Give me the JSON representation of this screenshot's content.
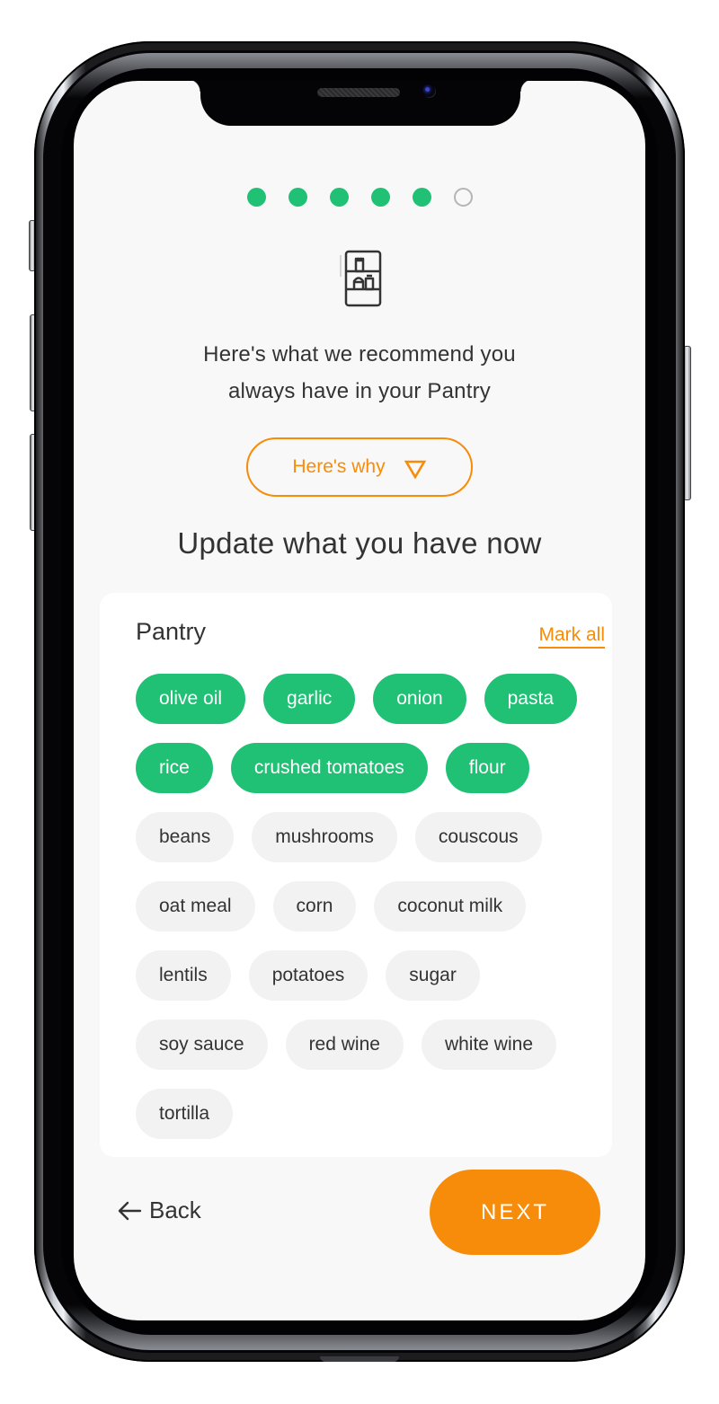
{
  "colors": {
    "accent_green": "#20c075",
    "accent_orange": "#f68c09",
    "text_primary": "#333333",
    "chip_unselected_bg": "#f2f2f2",
    "screen_bg": "#f8f8f8"
  },
  "progress": {
    "total_steps": 6,
    "completed_steps": 5,
    "steps": [
      {
        "state": "filled"
      },
      {
        "state": "filled"
      },
      {
        "state": "filled"
      },
      {
        "state": "filled"
      },
      {
        "state": "filled"
      },
      {
        "state": "empty"
      }
    ]
  },
  "header": {
    "icon": "pantry-shelf-icon",
    "intro_line1": "Here's what we recommend you",
    "intro_line2": "always have in your Pantry",
    "why_button_label": "Here's why",
    "why_button_icon": "triangle-down-icon",
    "update_heading": "Update what you have now"
  },
  "pantry": {
    "title": "Pantry",
    "mark_all_label": "Mark all",
    "items": [
      {
        "label": "olive oil",
        "selected": true
      },
      {
        "label": "garlic",
        "selected": true
      },
      {
        "label": "onion",
        "selected": true
      },
      {
        "label": "pasta",
        "selected": true
      },
      {
        "label": "rice",
        "selected": true
      },
      {
        "label": "crushed tomatoes",
        "selected": true
      },
      {
        "label": "flour",
        "selected": true
      },
      {
        "label": "beans",
        "selected": false
      },
      {
        "label": "mushrooms",
        "selected": false
      },
      {
        "label": "couscous",
        "selected": false
      },
      {
        "label": "oat meal",
        "selected": false
      },
      {
        "label": "corn",
        "selected": false
      },
      {
        "label": "coconut milk",
        "selected": false
      },
      {
        "label": "lentils",
        "selected": false
      },
      {
        "label": "potatoes",
        "selected": false
      },
      {
        "label": "sugar",
        "selected": false
      },
      {
        "label": "soy sauce",
        "selected": false
      },
      {
        "label": "red wine",
        "selected": false
      },
      {
        "label": "white wine",
        "selected": false
      },
      {
        "label": "tortilla",
        "selected": false
      }
    ]
  },
  "footer": {
    "back_label": "Back",
    "back_icon": "arrow-left-icon",
    "next_label": "NEXT"
  }
}
